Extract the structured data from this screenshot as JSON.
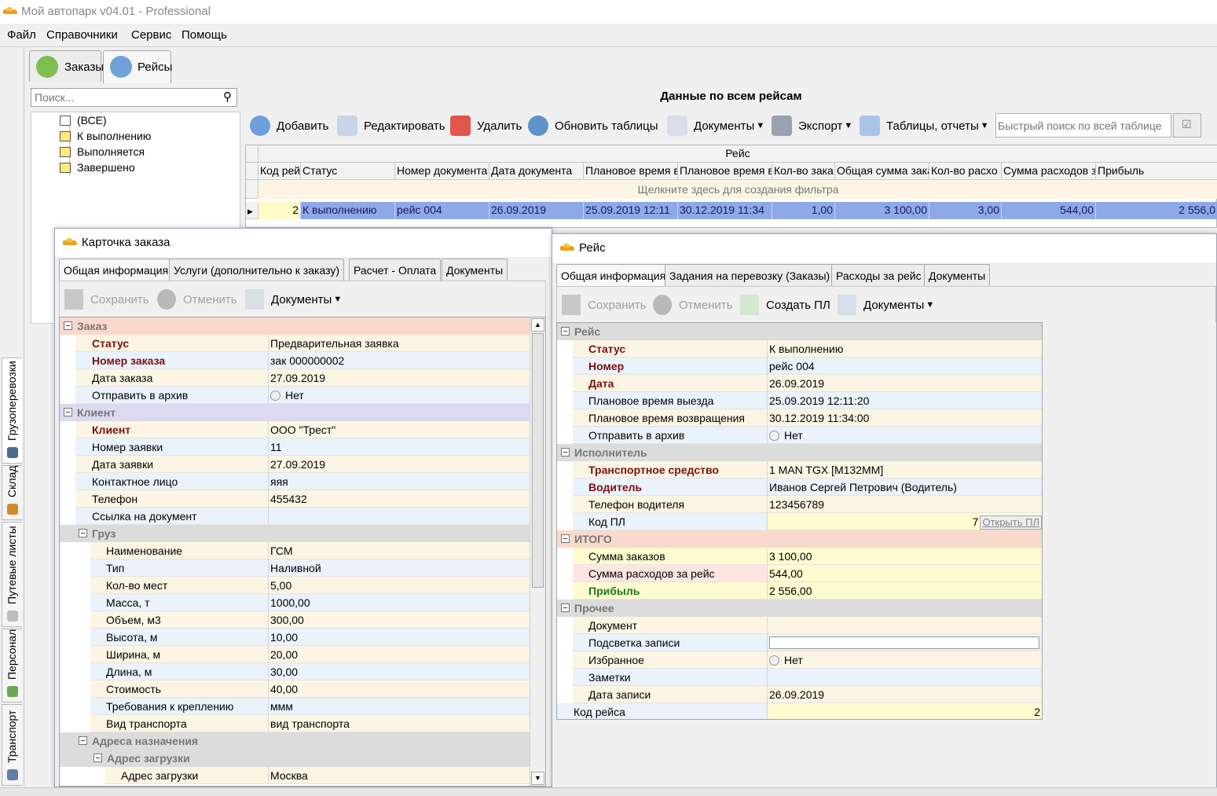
{
  "app": {
    "title": "Мой автопарк v04.01 - Professional"
  },
  "menu": [
    "Файл",
    "Справочники",
    "Сервис",
    "Помощь"
  ],
  "side_tabs": [
    "Грузоперевозки",
    "Склад",
    "Путевые листы",
    "Персонал",
    "Транспорт"
  ],
  "top_tabs": [
    "Заказы",
    "Рейсы"
  ],
  "search": {
    "placeholder": "Поиск..."
  },
  "tree": [
    "(ВСЕ)",
    "К выполнению",
    "Выполняется",
    "Завершено"
  ],
  "grid": {
    "title": "Данные по всем рейсам",
    "toolbar": {
      "add": "Добавить",
      "edit": "Редактировать",
      "delete": "Удалить",
      "refresh": "Обновить таблицы",
      "docs": "Документы",
      "export": "Экспорт",
      "reports": "Таблицы, отчеты"
    },
    "quick_search_placeholder": "Быстрый поиск по всей таблице",
    "band": "Рейс",
    "columns": [
      "Код рей",
      "Статус",
      "Номер документа",
      "Дата документа",
      "Плановое время в",
      "Плановое время в",
      "Кол-во зака",
      "Общая сумма зака",
      "Кол-во расхо",
      "Сумма расходов з",
      "Прибыль"
    ],
    "filter_hint": "Щелкните здесь для создания фильтра",
    "rows": [
      [
        "2",
        "К выполнению",
        "рейс 004",
        "26.09.2019",
        "25.09.2019 12:11",
        "30.12.2019 11:34",
        "1,00",
        "3 100,00",
        "3,00",
        "544,00",
        "2 556,0"
      ]
    ]
  },
  "order_card": {
    "title": "Карточка заказа",
    "tabs": [
      "Общая информация",
      "Услуги (дополнительно к заказу)",
      "Расчет - Оплата",
      "Документы"
    ],
    "toolbar": {
      "save": "Сохранить",
      "cancel": "Отменить",
      "docs": "Документы"
    },
    "cat_order": "Заказ",
    "status_k": "Статус",
    "status_v": "Предварительная заявка",
    "num_k": "Номер заказа",
    "num_v": "зак 000000002",
    "date_k": "Дата заказа",
    "date_v": "27.09.2019",
    "arch_k": "Отправить в архив",
    "arch_v": "Нет",
    "cat_client": "Клиент",
    "client_k": "Клиент",
    "client_v": "ООО \"Трест\"",
    "req_num_k": "Номер заявки",
    "req_num_v": "11",
    "req_date_k": "Дата заявки",
    "req_date_v": "27.09.2019",
    "contact_k": "Контактное лицо",
    "contact_v": "яяя",
    "phone_k": "Телефон",
    "phone_v": "455432",
    "link_k": "Ссылка на документ",
    "link_v": "",
    "cat_cargo": "Груз",
    "cargo": [
      {
        "k": "Наименование",
        "v": "ГСМ"
      },
      {
        "k": "Тип",
        "v": "Наливной"
      },
      {
        "k": "Кол-во мест",
        "v": "5,00"
      },
      {
        "k": "Масса, т",
        "v": "1000,00"
      },
      {
        "k": "Объем, м3",
        "v": "300,00"
      },
      {
        "k": "Высота, м",
        "v": "10,00"
      },
      {
        "k": "Ширина, м",
        "v": "20,00"
      },
      {
        "k": "Длина, м",
        "v": "30,00"
      },
      {
        "k": "Стоимость",
        "v": "40,00"
      },
      {
        "k": "Требования к креплению",
        "v": "ммм"
      },
      {
        "k": "Вид транспорта",
        "v": "вид транспорта"
      }
    ],
    "cat_addr": "Адреса назначения",
    "cat_load": "Адрес загрузки",
    "load_k": "Адрес загрузки",
    "load_v": "Москва"
  },
  "trip_card": {
    "title": "Рейс",
    "tabs": [
      "Общая информация",
      "Задания на перевозку (Заказы)",
      "Расходы за рейс",
      "Документы"
    ],
    "toolbar": {
      "save": "Сохранить",
      "cancel": "Отменить",
      "create": "Создать ПЛ",
      "docs": "Документы"
    },
    "cat_trip": "Рейс",
    "status_k": "Статус",
    "status_v": "К выполнению",
    "num_k": "Номер",
    "num_v": "рейс 004",
    "date_k": "Дата",
    "date_v": "26.09.2019",
    "dep_k": "Плановое время выезда",
    "dep_v": "25.09.2019 12:11:20",
    "ret_k": "Плановое время возвращения",
    "ret_v": "30.12.2019 11:34:00",
    "arch_k": "Отправить в архив",
    "arch_v": "Нет",
    "cat_exec": "Исполнитель",
    "veh_k": "Транспортное средство",
    "veh_v": "1 MAN TGX [M132MM]",
    "drv_k": "Водитель",
    "drv_v": "Иванов Сергей Петрович (Водитель)",
    "dphone_k": "Телефон водителя",
    "dphone_v": "123456789",
    "pl_k": "Код ПЛ",
    "pl_v": "7",
    "pl_btn": "Открыть ПЛ",
    "cat_total": "ИТОГО",
    "sum_k": "Сумма заказов",
    "sum_v": "3 100,00",
    "exp_k": "Сумма расходов за рейс",
    "exp_v": "544,00",
    "profit_k": "Прибыль",
    "profit_v": "2 556,00",
    "cat_other": "Прочее",
    "doc_k": "Документ",
    "doc_v": "",
    "hl_k": "Подсветка записи",
    "fav_k": "Избранное",
    "fav_v": "Нет",
    "notes_k": "Заметки",
    "notes_v": "",
    "rec_k": "Дата записи",
    "rec_v": "26.09.2019",
    "code_k": "Код рейса",
    "code_v": "2"
  },
  "colors": {
    "selection": "#8ea9e8",
    "required": "#7a1010",
    "profit": "#1b7a1b"
  }
}
